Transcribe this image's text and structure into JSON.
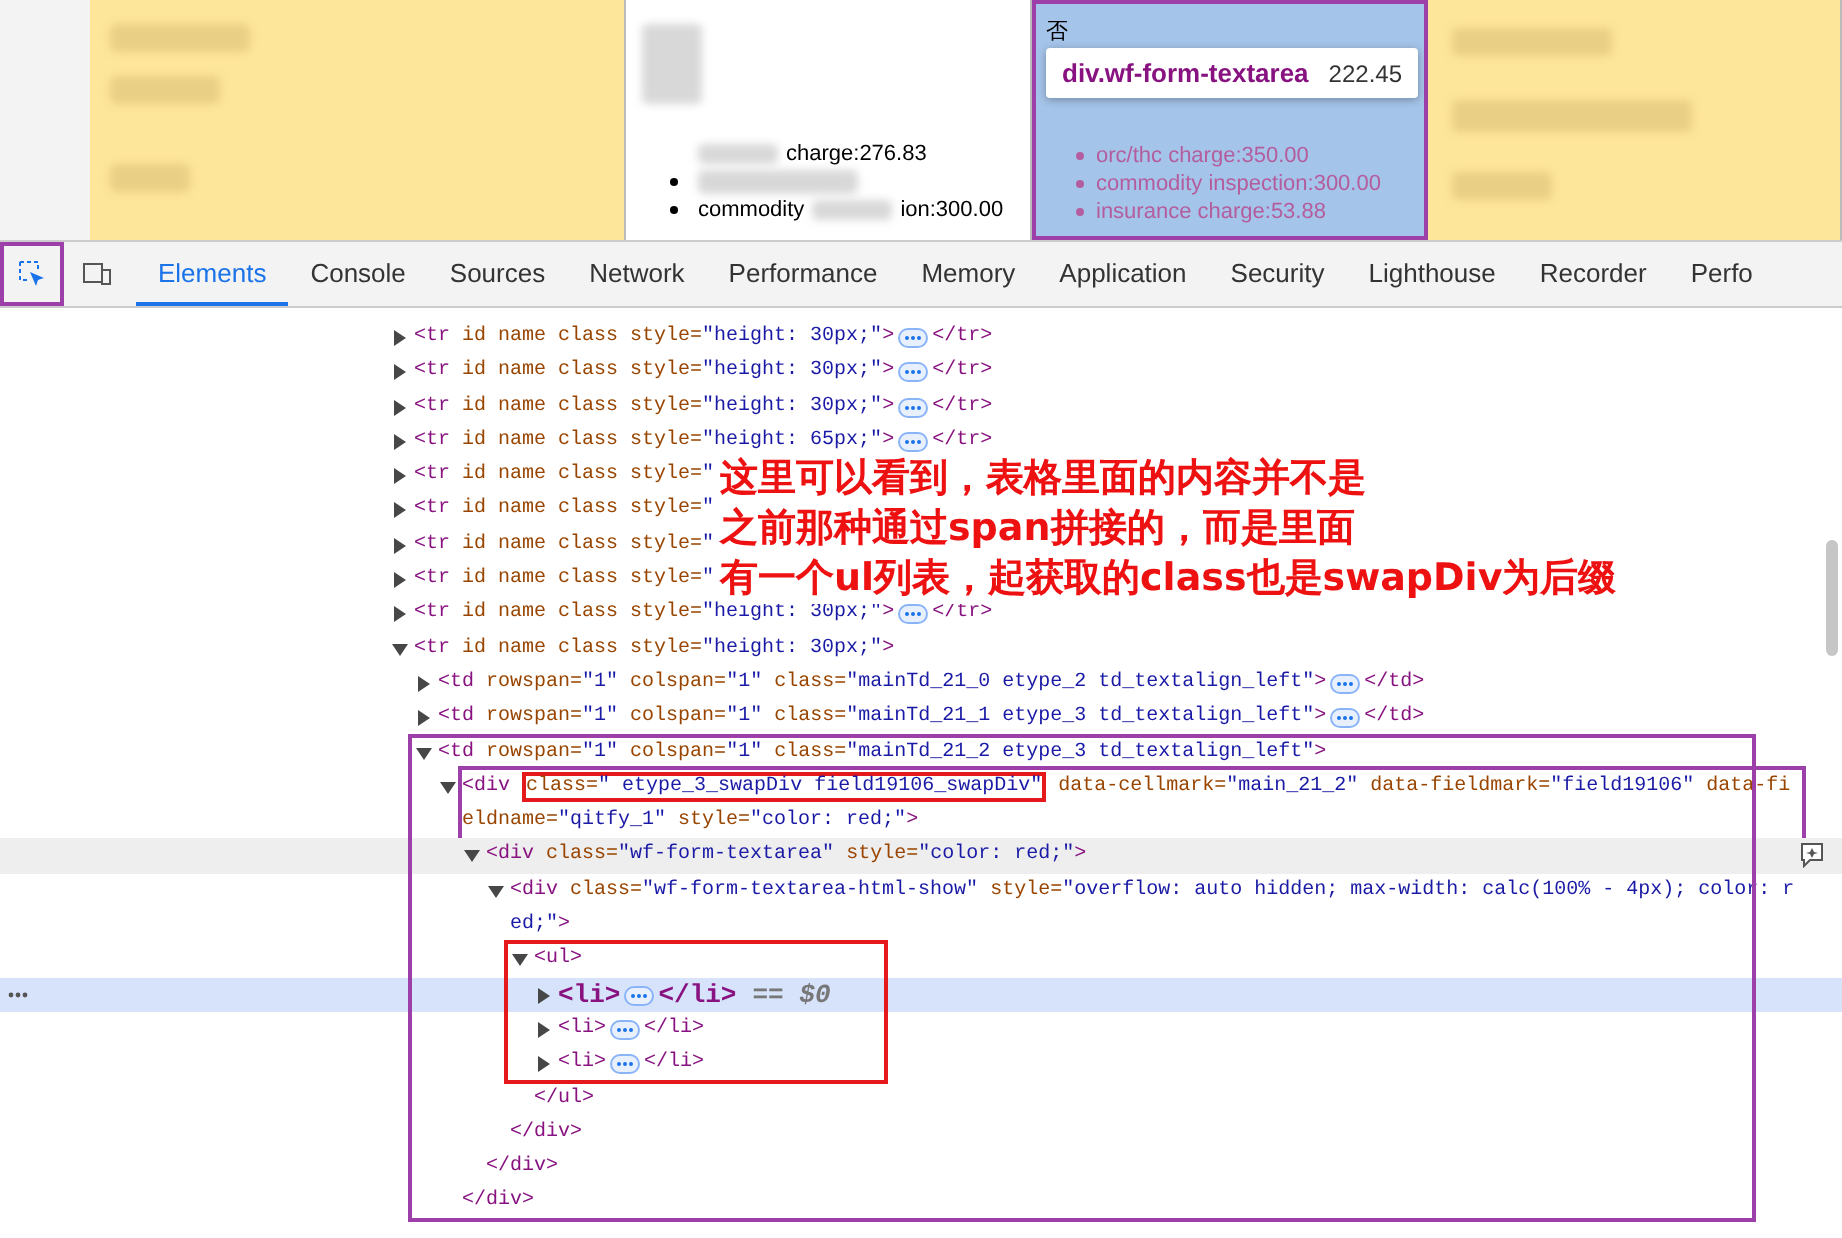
{
  "page": {
    "middle_cell": {
      "items": [
        {
          "kind": "tail",
          "texts": [
            "charge:276.83"
          ]
        },
        {
          "kind": "hidden"
        },
        {
          "kind": "split",
          "texts": [
            "commodity",
            "ion:300.00"
          ]
        }
      ]
    },
    "inspected_cell": {
      "header": "否",
      "tooltip": {
        "selector": "div.wf-form-textarea",
        "size": "222.45"
      },
      "items": [
        "orc/thc charge:350.00",
        "commodity inspection:300.00",
        "insurance charge:53.88"
      ]
    }
  },
  "toolbar": {
    "tools": [
      {
        "kind": "inspect",
        "selected": true,
        "boxed": true
      },
      {
        "kind": "device",
        "selected": false,
        "boxed": false
      }
    ],
    "tabs": [
      {
        "label": "Elements",
        "selected": true
      },
      {
        "label": "Console",
        "selected": false
      },
      {
        "label": "Sources",
        "selected": false
      },
      {
        "label": "Network",
        "selected": false
      },
      {
        "label": "Performance",
        "selected": false
      },
      {
        "label": "Memory",
        "selected": false
      },
      {
        "label": "Application",
        "selected": false
      },
      {
        "label": "Security",
        "selected": false
      },
      {
        "label": "Lighthouse",
        "selected": false
      },
      {
        "label": "Recorder",
        "selected": false
      },
      {
        "label": "Perfo",
        "selected": false
      }
    ]
  },
  "dom_tree": [
    {
      "open": "<tr id name class style=\"height: 30px;\">",
      "expanded": false,
      "close": "</tr>"
    },
    {
      "open": "<tr id name class style=\"height: 30px;\">",
      "expanded": false,
      "close": "</tr>"
    },
    {
      "open": "<tr id name class style=\"height: 30px;\">",
      "expanded": false,
      "close": "</tr>"
    },
    {
      "open": "<tr id name class style=\"height: 65px;\">",
      "expanded": false,
      "close": "</tr>"
    },
    {
      "open": "<tr id name class style=\"",
      "expanded": false
    },
    {
      "open": "<tr id name class style=\"",
      "expanded": false
    },
    {
      "open": "<tr id name class style=\"",
      "expanded": false
    },
    {
      "open": "<tr id name class style=\"",
      "expanded": false
    },
    {
      "open": "<tr id name class style=\"height: 30px;\">",
      "expanded": false,
      "close": "</tr>"
    },
    {
      "open": "<tr id name class style=\"height: 30px;\">",
      "expanded": true,
      "children": [
        {
          "open": "<td rowspan=\"1\" colspan=\"1\" class=\"mainTd_21_0 etype_2 td_textalign_left\">",
          "expanded": false,
          "close": "</td>"
        },
        {
          "open": "<td rowspan=\"1\" colspan=\"1\" class=\"mainTd_21_1 etype_3 td_textalign_left\">",
          "expanded": false,
          "close": "</td>"
        },
        {
          "open": "<td rowspan=\"1\" colspan=\"1\" class=\"mainTd_21_2 etype_3 td_textalign_left\">",
          "expanded": true,
          "purple_box": true,
          "children": [
            {
              "open_parts": [
                {
                  "text": "<div ",
                  "boxed": false
                },
                {
                  "text": "class=\" etype_3_swapDiv field19106_swapDiv\"",
                  "boxed": true
                },
                {
                  "text": " data-cellmark=\"main_21_2\" data-fieldmark=\"field19106\" data-fieldname=\"qitfy_1\" style=\"color: red;\">",
                  "boxed": false
                }
              ],
              "expanded": true,
              "line_boxed": true,
              "close": "</div>",
              "children": [
                {
                  "open": "<div class=\"wf-form-textarea\" style=\"color: red;\">",
                  "expanded": true,
                  "hovered": true,
                  "close": "</div>",
                  "children": [
                    {
                      "open": "<div class=\"wf-form-textarea-html-show\" style=\"overflow: auto hidden; max-width: calc(100% - 4px); color: red;\">",
                      "expanded": true,
                      "close": "</div>",
                      "children": [
                        {
                          "open": "<ul>",
                          "expanded": true,
                          "red_box": true,
                          "close": "</ul>",
                          "children": [
                            {
                              "open": "<li>",
                              "expanded": false,
                              "selected": true,
                              "console_ref": "== $0",
                              "close": "</li>"
                            },
                            {
                              "open": "<li>",
                              "expanded": false,
                              "selected": false,
                              "close": "</li>"
                            },
                            {
                              "open": "<li>",
                              "expanded": false,
                              "selected": false,
                              "close": "</li>"
                            }
                          ]
                        }
                      ]
                    }
                  ]
                }
              ]
            }
          ]
        }
      ]
    }
  ],
  "annotation": {
    "lines": [
      "这里可以看到，表格里面的内容并不是",
      "之前那种通过span拼接的，而是里面",
      "有一个ul列表，起获取的class也是swapDiv为后缀"
    ]
  }
}
